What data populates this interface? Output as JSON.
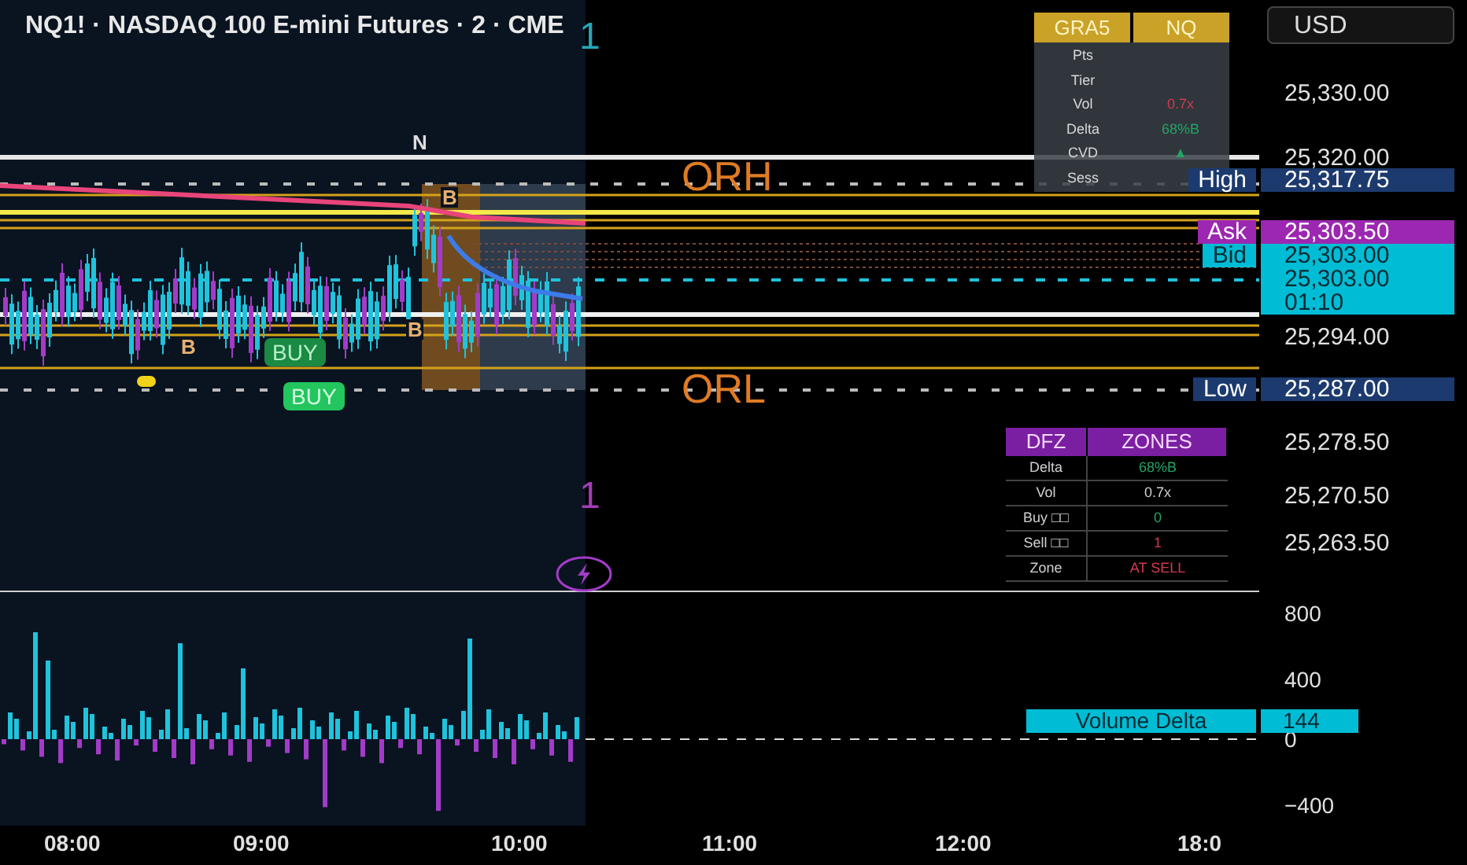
{
  "title": "NQ1! · NASDAQ 100 E-mini Futures · 2 · CME",
  "currency_button": "USD",
  "period_markers": [
    {
      "text": "1",
      "color": "#26a6b8"
    },
    {
      "text": "1",
      "color": "#a23cb8"
    }
  ],
  "range_labels": {
    "high": "ORH",
    "low": "ORL"
  },
  "chart_markers": [
    {
      "kind": "letter",
      "text": "N"
    },
    {
      "kind": "letter",
      "text": "B"
    },
    {
      "kind": "letter",
      "text": "B"
    },
    {
      "kind": "letter",
      "text": "B"
    },
    {
      "kind": "signal",
      "text": "BUY",
      "faded": true
    },
    {
      "kind": "signal",
      "text": "BUY",
      "faded": false
    }
  ],
  "info_table": {
    "headers": [
      "GRA5",
      "NQ"
    ],
    "rows": [
      {
        "label": "Pts"
      },
      {
        "label": "Tier"
      },
      {
        "label": "Vol",
        "value": "0.7x",
        "color": "#d33a4a"
      },
      {
        "label": "Delta",
        "value": "68%B",
        "color": "#22a565"
      },
      {
        "label": "CVD",
        "value": "▲",
        "color": "#22a565"
      },
      {
        "label": "Sess"
      }
    ]
  },
  "zones_table": {
    "headers": [
      "DFZ",
      "ZONES"
    ],
    "rows": [
      {
        "label": "Delta",
        "value": "68%B",
        "color": "#22a565"
      },
      {
        "label": "Vol",
        "value": "0.7x",
        "color": "#cfcfcf"
      },
      {
        "label": "Buy □□",
        "value": "0",
        "color": "#22a565"
      },
      {
        "label": "Sell □□",
        "value": "1",
        "color": "#d33a4a"
      },
      {
        "label": "Zone",
        "value": "AT SELL",
        "color": "#d33a4a"
      }
    ]
  },
  "price_axis": {
    "ticks": [
      "25,330.00",
      "25,320.00",
      "25,294.00",
      "25,278.50",
      "25,270.50",
      "25,263.50"
    ],
    "tags": [
      {
        "kind": "high",
        "label": "High",
        "price": "25,317.75"
      },
      {
        "kind": "ask",
        "label": "Ask",
        "price": "25,303.50"
      },
      {
        "kind": "bid",
        "label": "Bid",
        "price": "25,303.00"
      },
      {
        "kind": "last",
        "price": "25,303.00",
        "countdown": "01:10"
      },
      {
        "kind": "low",
        "label": "Low",
        "price": "25,287.00"
      }
    ]
  },
  "volume_pane": {
    "ticks": [
      "800",
      "400",
      "0",
      "−400"
    ],
    "tag": {
      "label": "Volume Delta",
      "value": "144"
    }
  },
  "time_axis": [
    "08:00",
    "09:00",
    "10:00",
    "11:00",
    "12:00",
    "18:0"
  ]
}
